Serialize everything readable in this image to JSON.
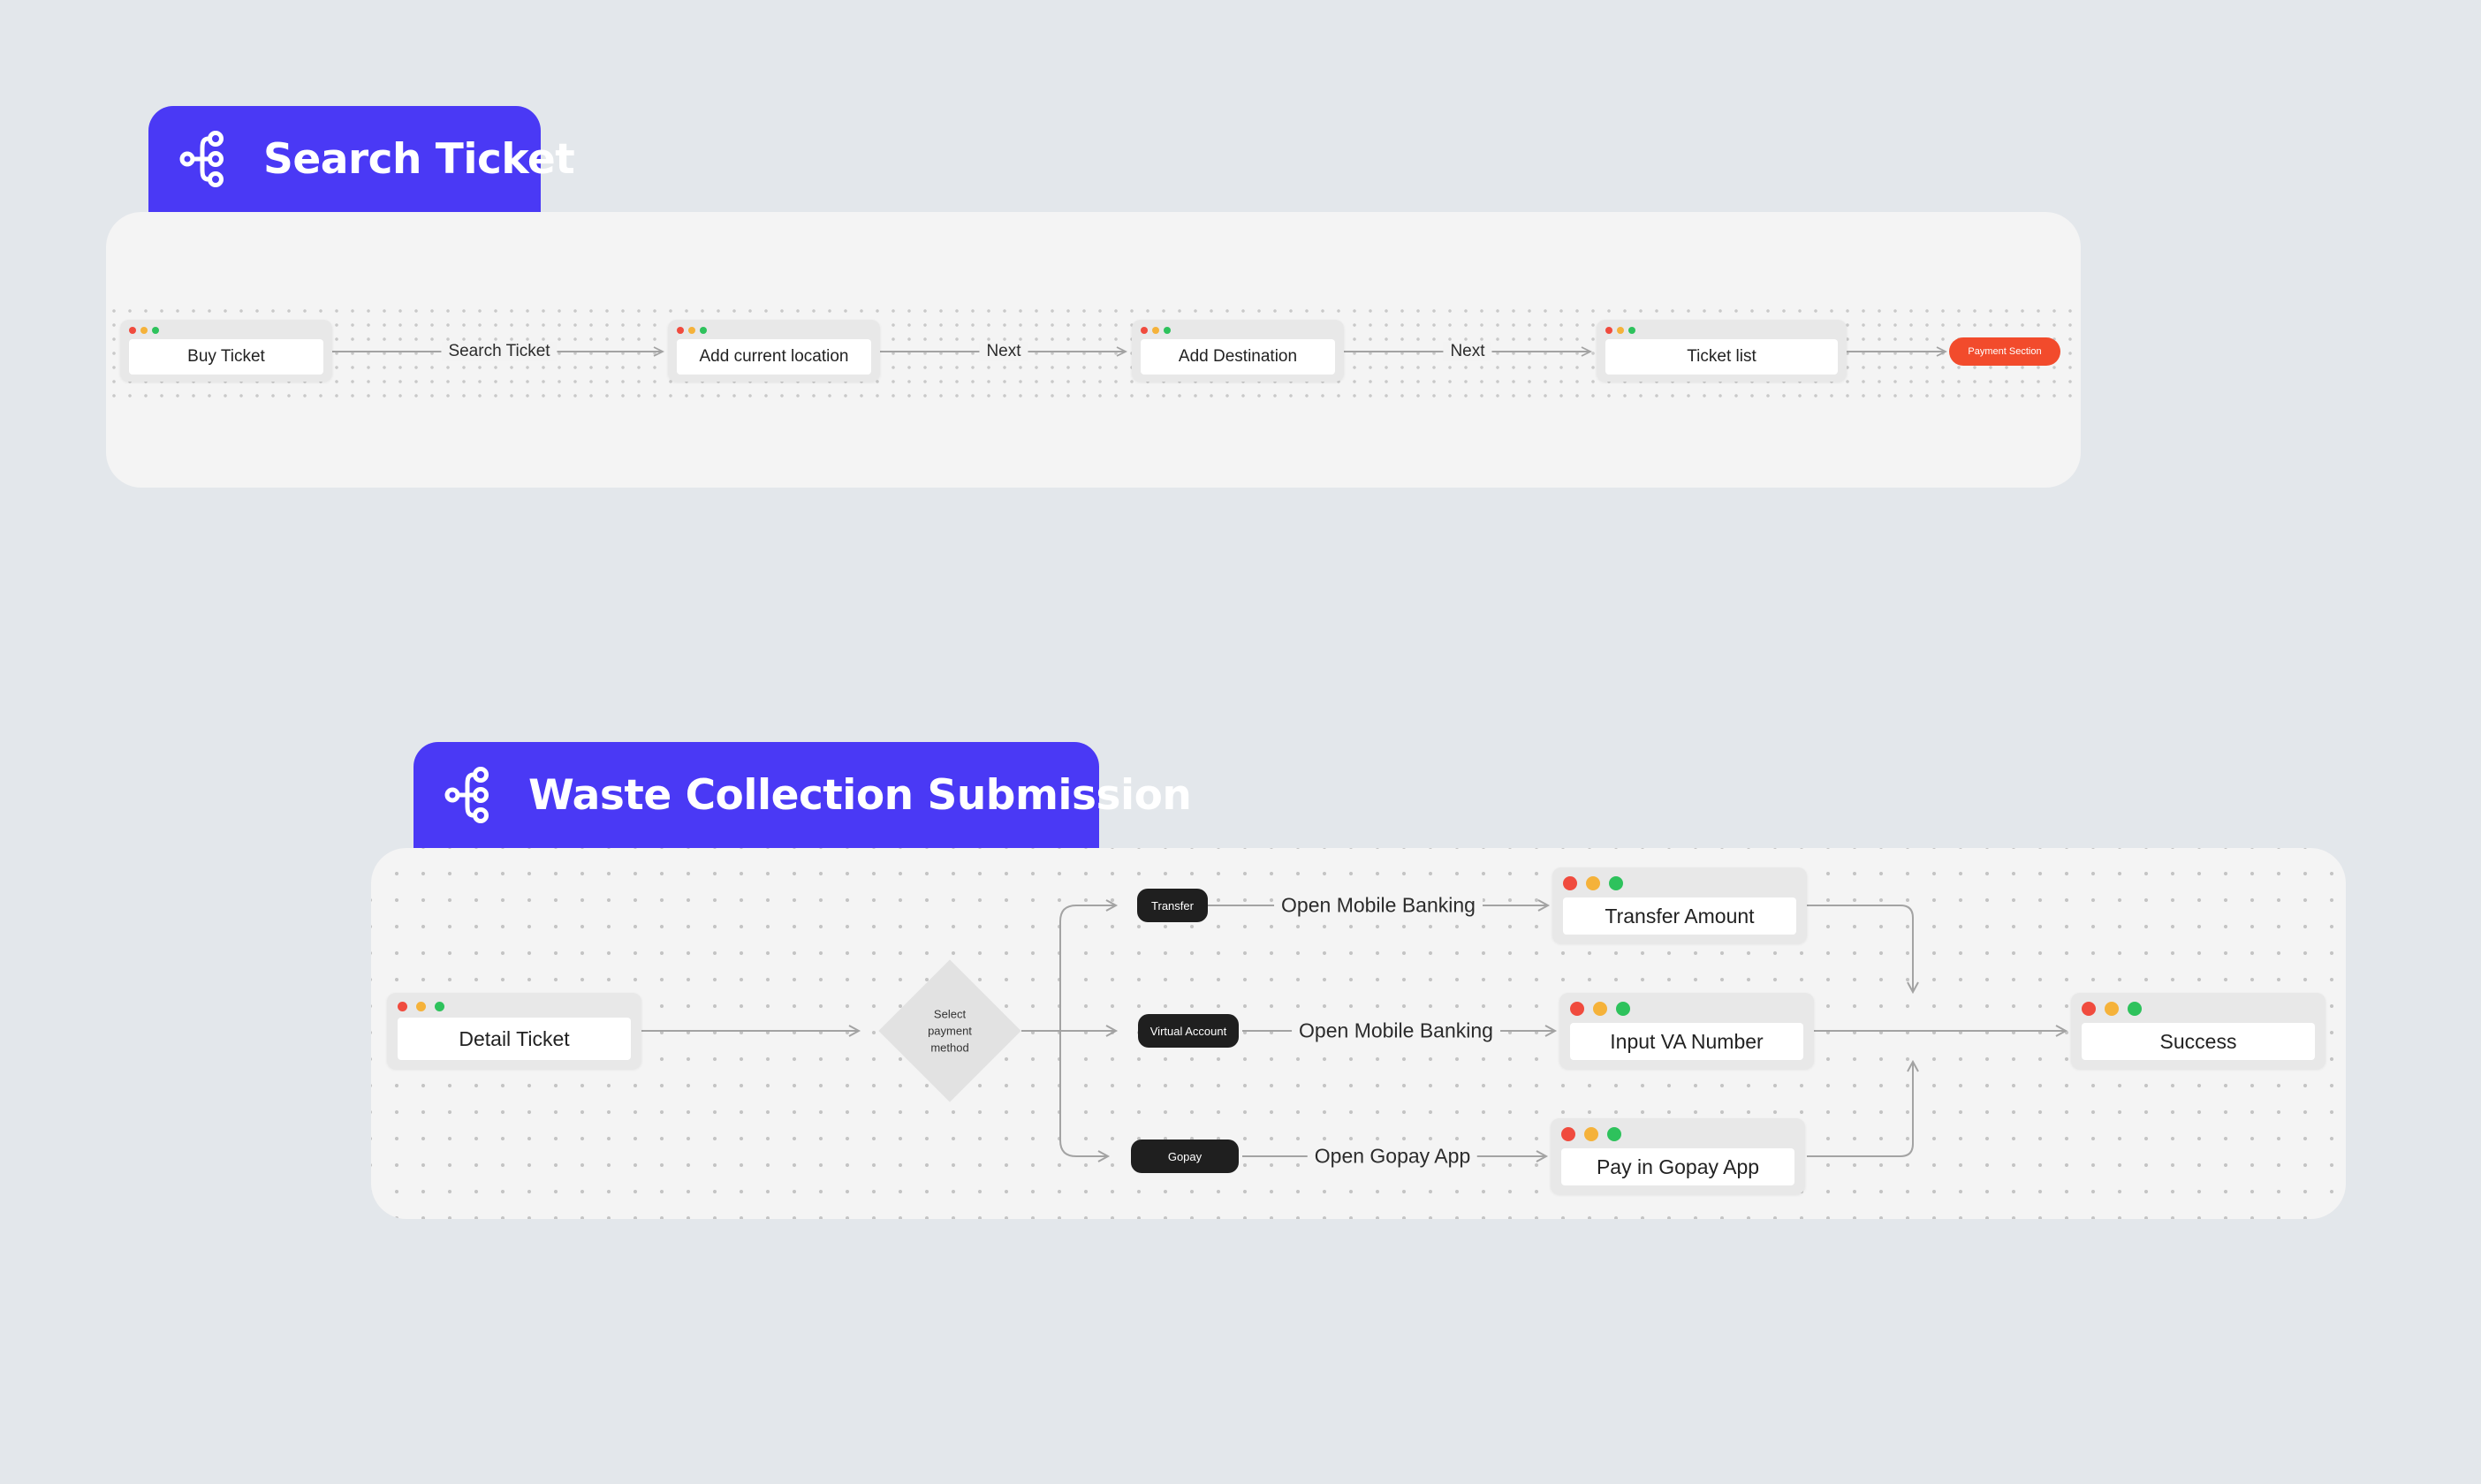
{
  "colors": {
    "background": "#e3e7eb",
    "tab": "#4a39f5",
    "panel": "#f4f4f4",
    "pill": "#1f1f1f",
    "payment_pill": "#f24b2c",
    "light_red": "#f04b3e",
    "light_yellow": "#f5b23a",
    "light_green": "#2ec25c",
    "connector": "#a3a3a3"
  },
  "search_ticket": {
    "title": "Search Ticket",
    "icon": "flow-tree-icon",
    "nodes": [
      "Buy Ticket",
      "Add current location",
      "Add Destination",
      "Ticket list"
    ],
    "edges": [
      "Search Ticket",
      "Next",
      "Next"
    ],
    "end_pill": "Payment Section"
  },
  "waste_collection": {
    "title": "Waste Collection Submission",
    "icon": "flow-tree-icon",
    "start_node": "Detail Ticket",
    "decision": [
      "Select",
      "payment",
      "method"
    ],
    "branches": [
      {
        "pill": "Transfer",
        "action": "Open Mobile Banking",
        "node": "Transfer Amount"
      },
      {
        "pill": "Virtual Account",
        "action": "Open Mobile Banking",
        "node": "Input VA Number"
      },
      {
        "pill": "Gopay",
        "action": "Open Gopay App",
        "node": "Pay in Gopay App"
      }
    ],
    "end_node": "Success"
  }
}
